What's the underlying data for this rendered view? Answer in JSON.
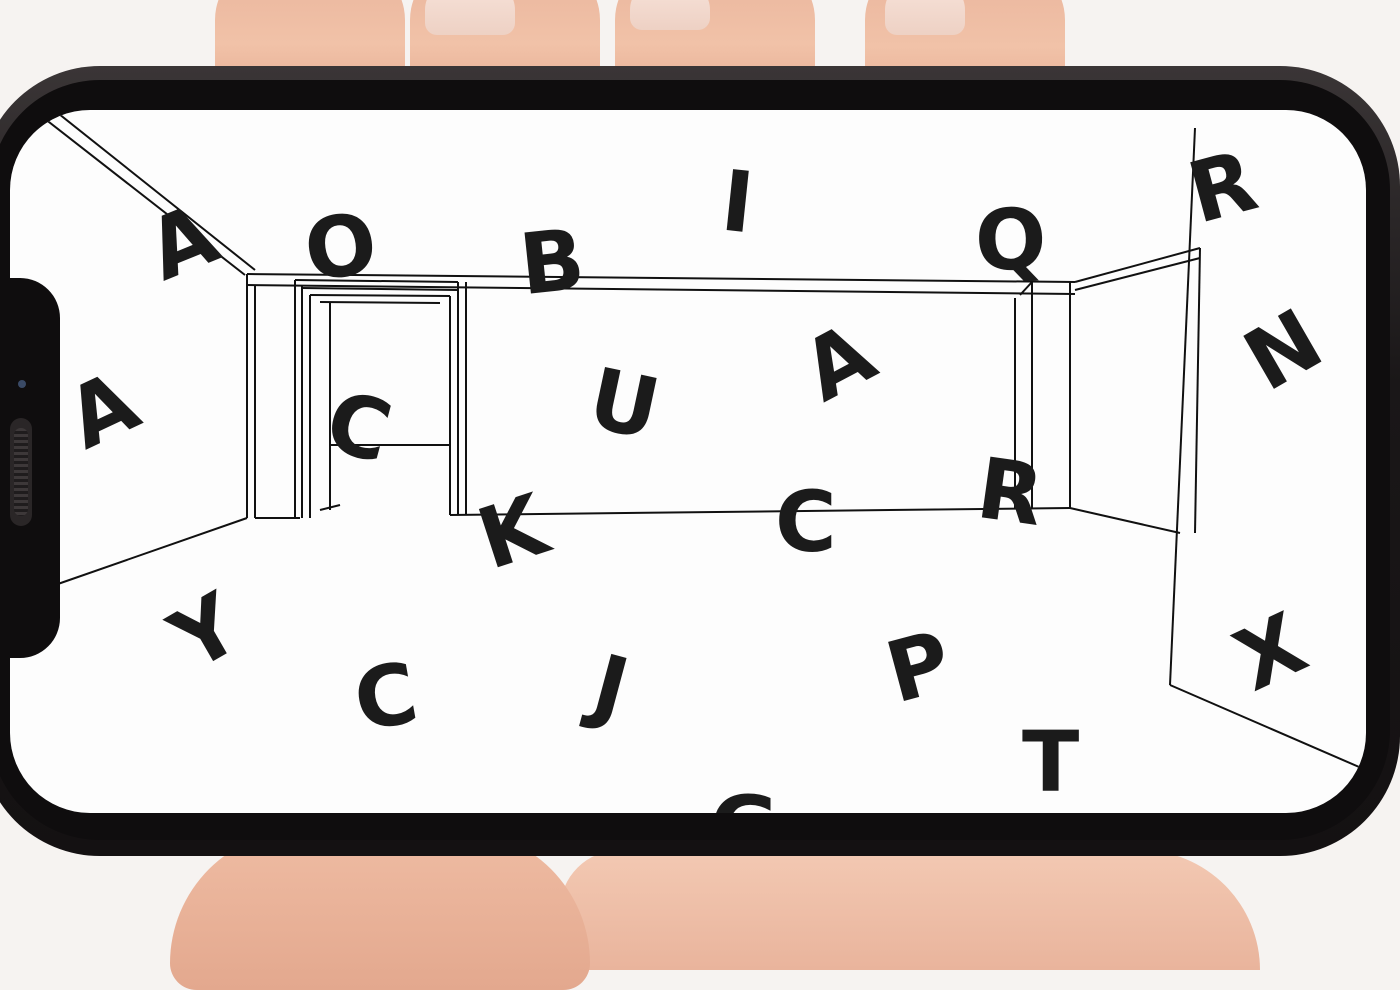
{
  "letters": [
    "A",
    "O",
    "B",
    "I",
    "Q",
    "R",
    "A",
    "C",
    "U",
    "A",
    "N",
    "K",
    "C",
    "R",
    "Y",
    "C",
    "J",
    "P",
    "X",
    "T",
    "G"
  ],
  "colors": {
    "screen": "#fdfdfd",
    "ink": "#1b1b1b",
    "phone_frame": "#141112",
    "skin": "#efbca3"
  },
  "icons": [
    "phone-speaker-icon",
    "front-camera-icon"
  ]
}
